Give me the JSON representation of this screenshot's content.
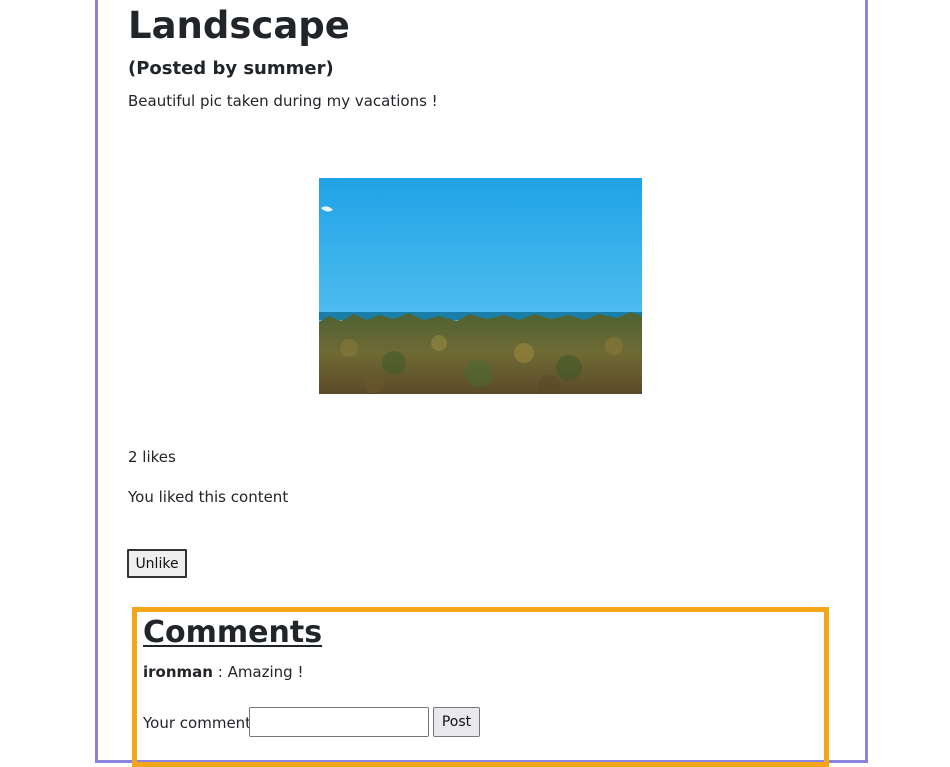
{
  "post": {
    "title": "Landscape",
    "author_line": "(Posted by summer)",
    "description": "Beautiful pic taken during my vacations !",
    "image_alt": "landscape photo of blue sky, sea horizon and green shrubland",
    "likes_text": "2 likes",
    "liked_text": "You liked this content",
    "unlike_label": "Unlike"
  },
  "comments": {
    "heading": "Comments",
    "items": [
      {
        "user": "ironman",
        "separator": " : ",
        "text": "Amazing !"
      }
    ],
    "form": {
      "label": "Your comment:",
      "input_value": "",
      "submit_label": "Post"
    }
  },
  "colors": {
    "post_border": "#8a84dd",
    "comments_border": "#f4a519"
  }
}
